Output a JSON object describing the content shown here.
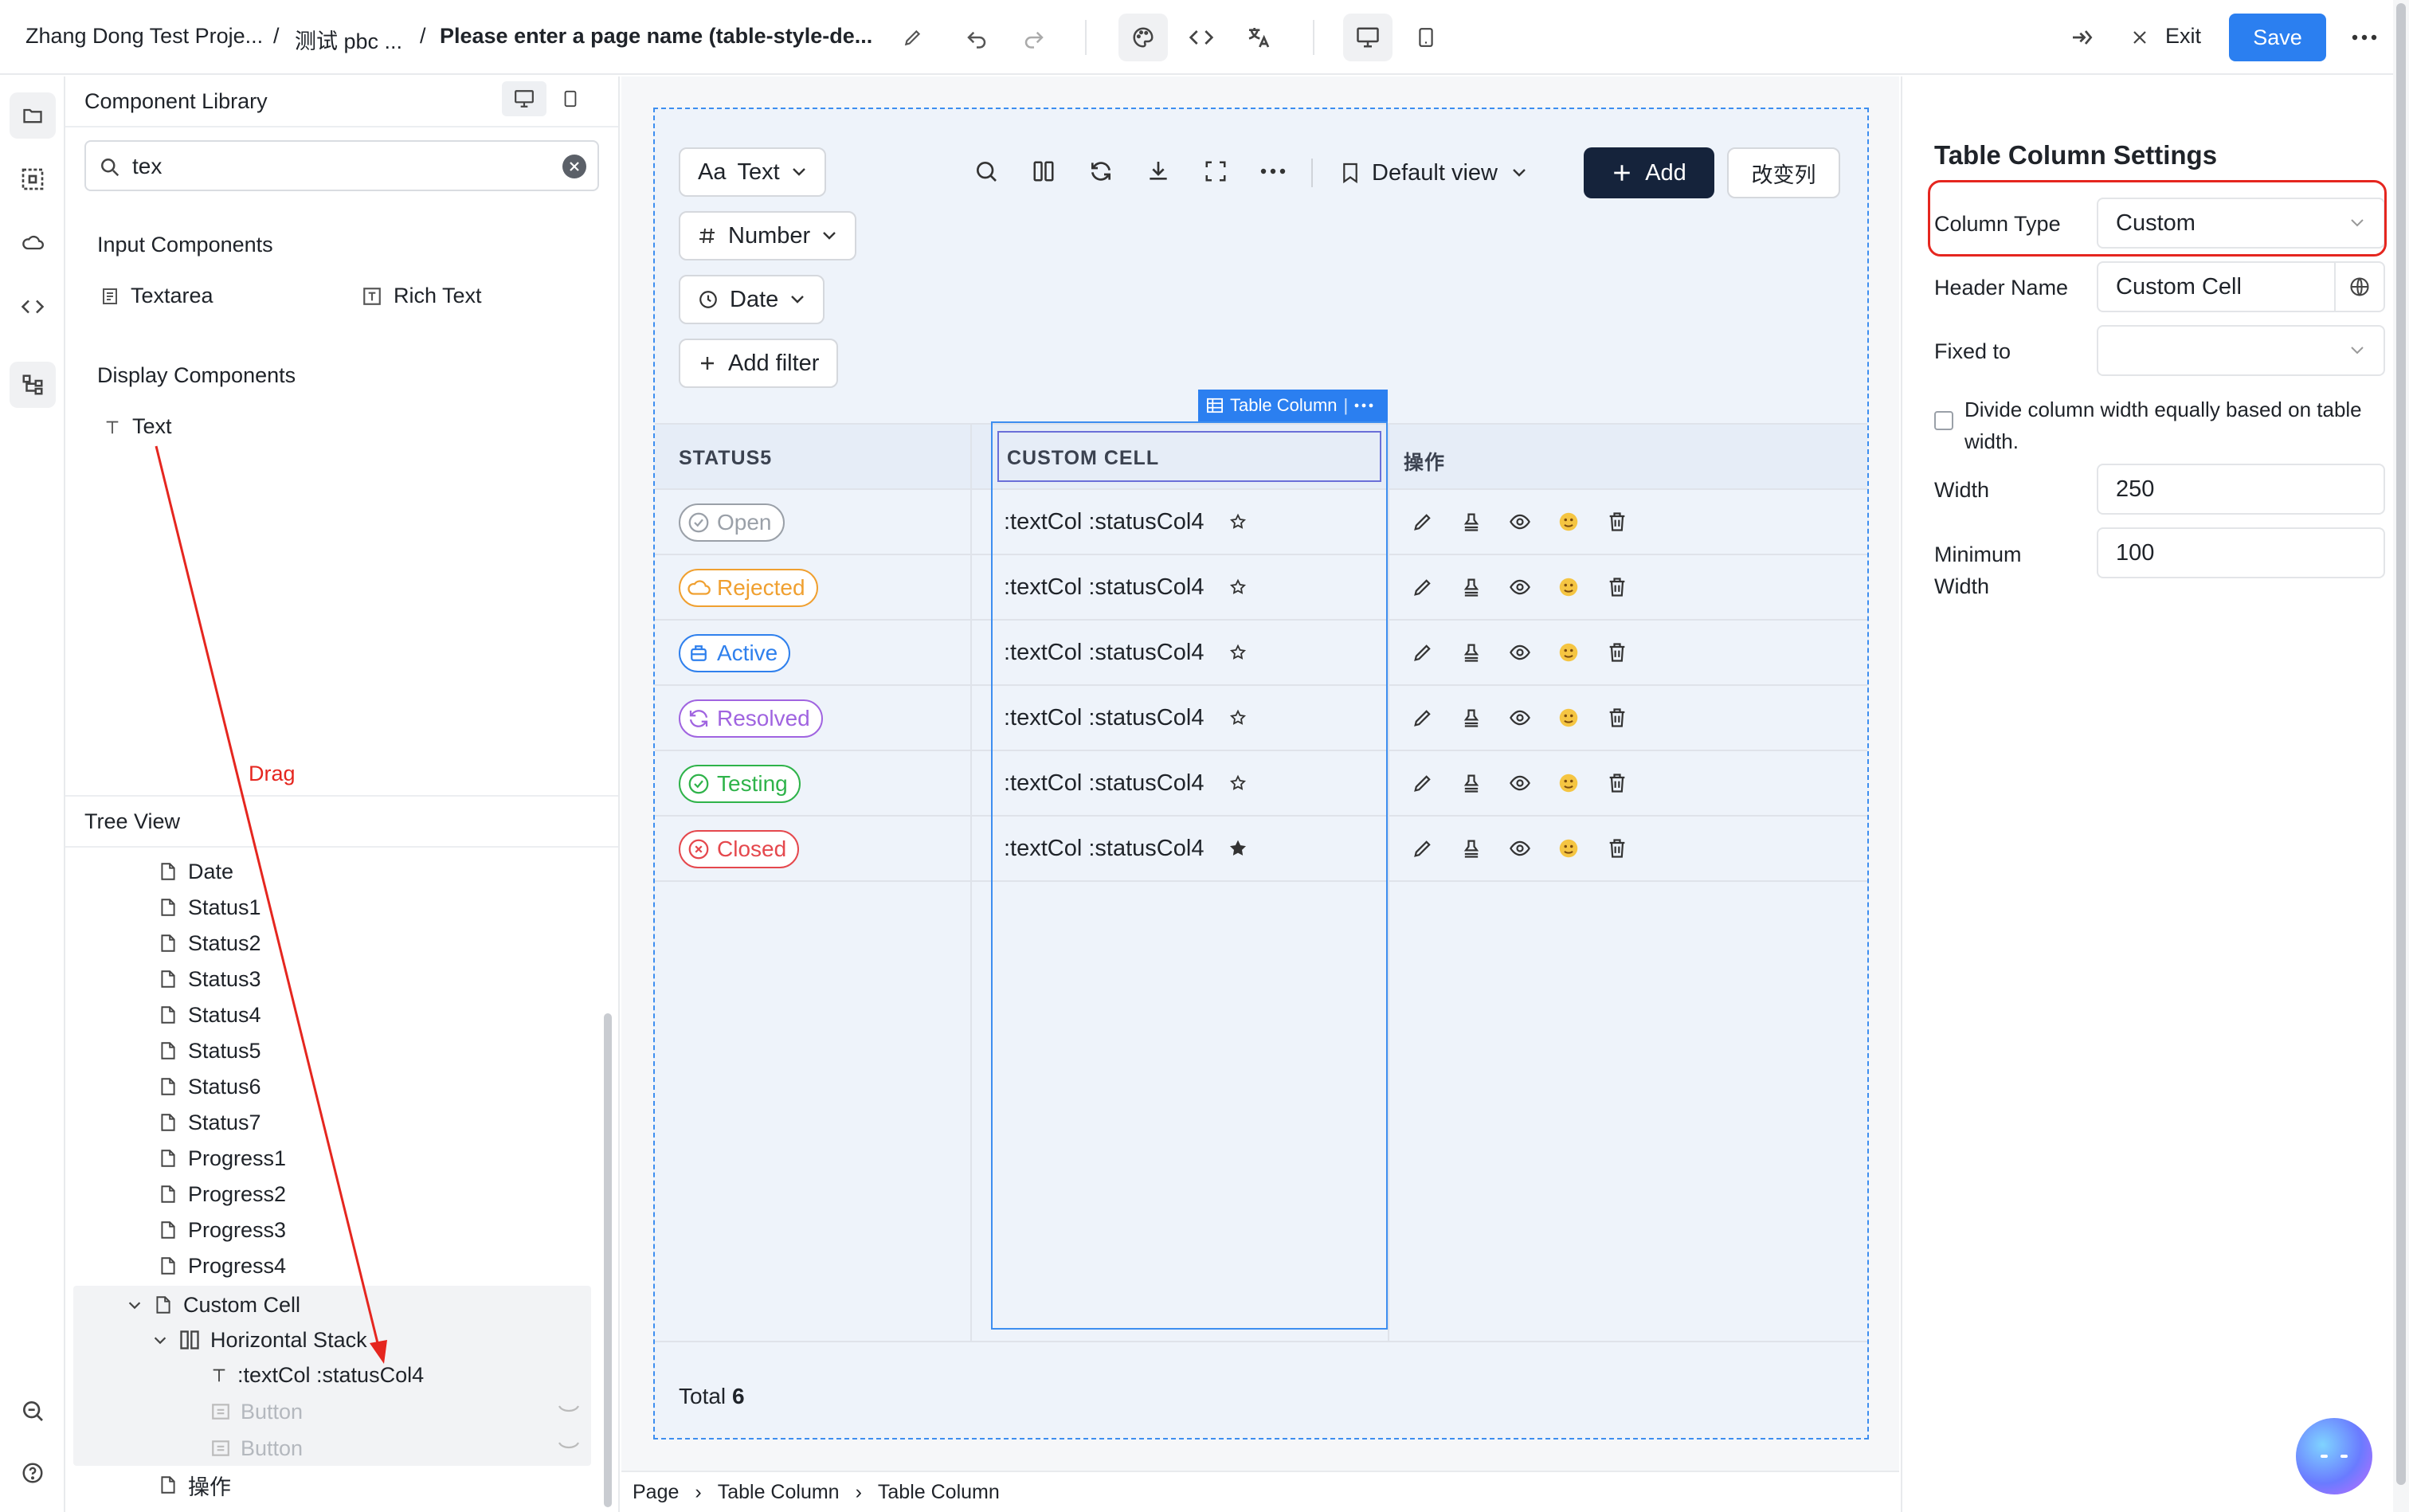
{
  "topbar": {
    "project": "Zhang Dong Test Proje...",
    "sep1": "/",
    "app": "测试 pbc ...",
    "sep2": "/",
    "page_name": "Please enter a page name (table-style-de...",
    "exit": "Exit",
    "save": "Save"
  },
  "library": {
    "title": "Component Library",
    "search_value": "tex",
    "sections": [
      {
        "title": "Input Components",
        "items": [
          "Textarea",
          "Rich Text"
        ]
      },
      {
        "title": "Display Components",
        "items": [
          "Text"
        ]
      }
    ]
  },
  "annotation": {
    "drag": "Drag"
  },
  "tree": {
    "title": "Tree View",
    "items": [
      "Date",
      "Status1",
      "Status2",
      "Status3",
      "Status4",
      "Status5",
      "Status6",
      "Status7",
      "Progress1",
      "Progress2",
      "Progress3",
      "Progress4"
    ],
    "custom_cell": "Custom Cell",
    "horizontal_stack": "Horizontal Stack",
    "text_node": ":textCol :statusCol4",
    "button1": "Button",
    "button2": "Button",
    "ops": "操作"
  },
  "toolbar": {
    "text_filter": "Text",
    "text_prefix": "Aa",
    "number_filter": "Number",
    "date_filter": "Date",
    "add_filter": "Add filter",
    "view": "Default view",
    "add": "Add",
    "change_cols": "改变列"
  },
  "table": {
    "selection_tag": "Table Column",
    "headers": [
      "STATUS5",
      "CUSTOM CELL",
      "操作"
    ],
    "rows": [
      {
        "status": "Open",
        "color": "#9aa0a8",
        "cell": ":textCol :statusCol4",
        "starred": false
      },
      {
        "status": "Rejected",
        "color": "#f0a030",
        "cell": ":textCol :statusCol4",
        "starred": false
      },
      {
        "status": "Active",
        "color": "#2f80ed",
        "cell": ":textCol :statusCol4",
        "starred": false
      },
      {
        "status": "Resolved",
        "color": "#a064e0",
        "cell": ":textCol :statusCol4",
        "starred": false
      },
      {
        "status": "Testing",
        "color": "#2fb34a",
        "cell": ":textCol :statusCol4",
        "starred": false
      },
      {
        "status": "Closed",
        "color": "#e5484d",
        "cell": ":textCol :statusCol4",
        "starred": true
      }
    ],
    "total_label": "Total",
    "total_value": "6"
  },
  "breadcrumb": [
    "Page",
    "Table Column",
    "Table Column"
  ],
  "settings": {
    "title": "Table Column Settings",
    "column_type_label": "Column Type",
    "column_type_value": "Custom",
    "header_name_label": "Header Name",
    "header_name_value": "Custom Cell",
    "fixed_to_label": "Fixed to",
    "fixed_to_value": "",
    "divide_label": "Divide column width equally based on table width.",
    "width_label": "Width",
    "width_value": "250",
    "min_width_label": "Minimum Width",
    "min_width_value": "100"
  },
  "colors": {
    "accent": "#2b7ff0",
    "primary_dark": "#15233b",
    "highlight_red": "#e5261f"
  }
}
